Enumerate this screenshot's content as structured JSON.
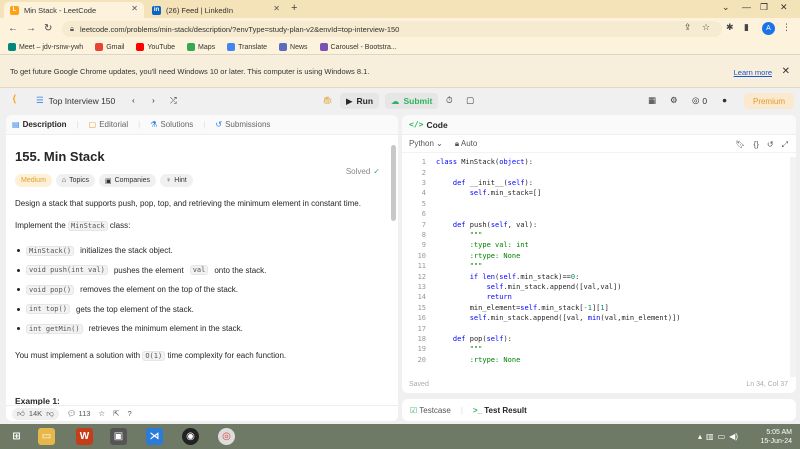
{
  "browser": {
    "tabs": [
      {
        "label": "Min Stack - LeetCode",
        "favicon": "L",
        "fav_color": "#ffa116"
      },
      {
        "label": "(26) Feed | LinkedIn",
        "favicon": "in",
        "fav_color": "#0a66c2"
      }
    ],
    "url": "leetcode.com/problems/min-stack/description/?envType=study-plan-v2&envId=top-interview-150",
    "bookmarks": [
      {
        "label": "Meet – jdv-rsnw-ywh",
        "color": "#00897b"
      },
      {
        "label": "Gmail",
        "color": "#ea4335"
      },
      {
        "label": "YouTube",
        "color": "#ff0000"
      },
      {
        "label": "Maps",
        "color": "#34a853"
      },
      {
        "label": "Translate",
        "color": "#4285f4"
      },
      {
        "label": "News",
        "color": "#5c6bc0"
      },
      {
        "label": "Carousel - Bootstra...",
        "color": "#7952b3"
      }
    ],
    "avatar_letter": "A"
  },
  "infobar": {
    "message": "To get future Google Chrome updates, you'll need Windows 10 or later. This computer is using Windows 8.1.",
    "learn_more": "Learn more"
  },
  "lc_nav": {
    "list_title": "Top Interview 150",
    "run_label": "Run",
    "submit_label": "Submit",
    "coins": "0",
    "premium_label": "Premium"
  },
  "description": {
    "tabs": [
      "Description",
      "Editorial",
      "Solutions",
      "Submissions"
    ],
    "title": "155. Min Stack",
    "solved_label": "Solved",
    "badges": [
      "Medium",
      "Topics",
      "Companies",
      "Hint"
    ],
    "intro": "Design a stack that supports push, pop, top, and retrieving the minimum element in constant time.",
    "implement_prefix": "Implement the",
    "implement_code": "MinStack",
    "implement_suffix": "class:",
    "bullets": [
      {
        "code": "MinStack()",
        "text": "initializes the stack object."
      },
      {
        "code": "void push(int val)",
        "text": "pushes the element",
        "code2": "val",
        "text2": "onto the stack."
      },
      {
        "code": "void pop()",
        "text": "removes the element on the top of the stack."
      },
      {
        "code": "int top()",
        "text": "gets the top element of the stack."
      },
      {
        "code": "int getMin()",
        "text": "retrieves the minimum element in the stack."
      }
    ],
    "complexity_prefix": "You must implement a solution with",
    "complexity_code": "O(1)",
    "complexity_suffix": "time complexity for each function.",
    "example_heading": "Example 1:",
    "likes": "14K",
    "comments": "113"
  },
  "editor": {
    "header": "Code",
    "language": "Python",
    "mode": "Auto",
    "status": "Saved",
    "position": "Ln 34, Col 37",
    "lines": [
      "class MinStack(object):",
      "",
      "    def __init__(self):",
      "        self.min_stack=[]",
      "",
      "",
      "    def push(self, val):",
      "        \"\"\"",
      "        :type val: int",
      "        :rtype: None",
      "        \"\"\"",
      "        if len(self.min_stack)==0:",
      "            self.min_stack.append([val,val])",
      "            return",
      "        min_element=self.min_stack[-1][1]",
      "        self.min_stack.append([val, min(val,min_element)])",
      "",
      "    def pop(self):",
      "        \"\"\"",
      "        :rtype: None"
    ]
  },
  "console": {
    "testcase_label": "Testcase",
    "result_label": "Test Result"
  },
  "taskbar": {
    "time": "5:05 AM",
    "date": "15-Jun-24"
  }
}
